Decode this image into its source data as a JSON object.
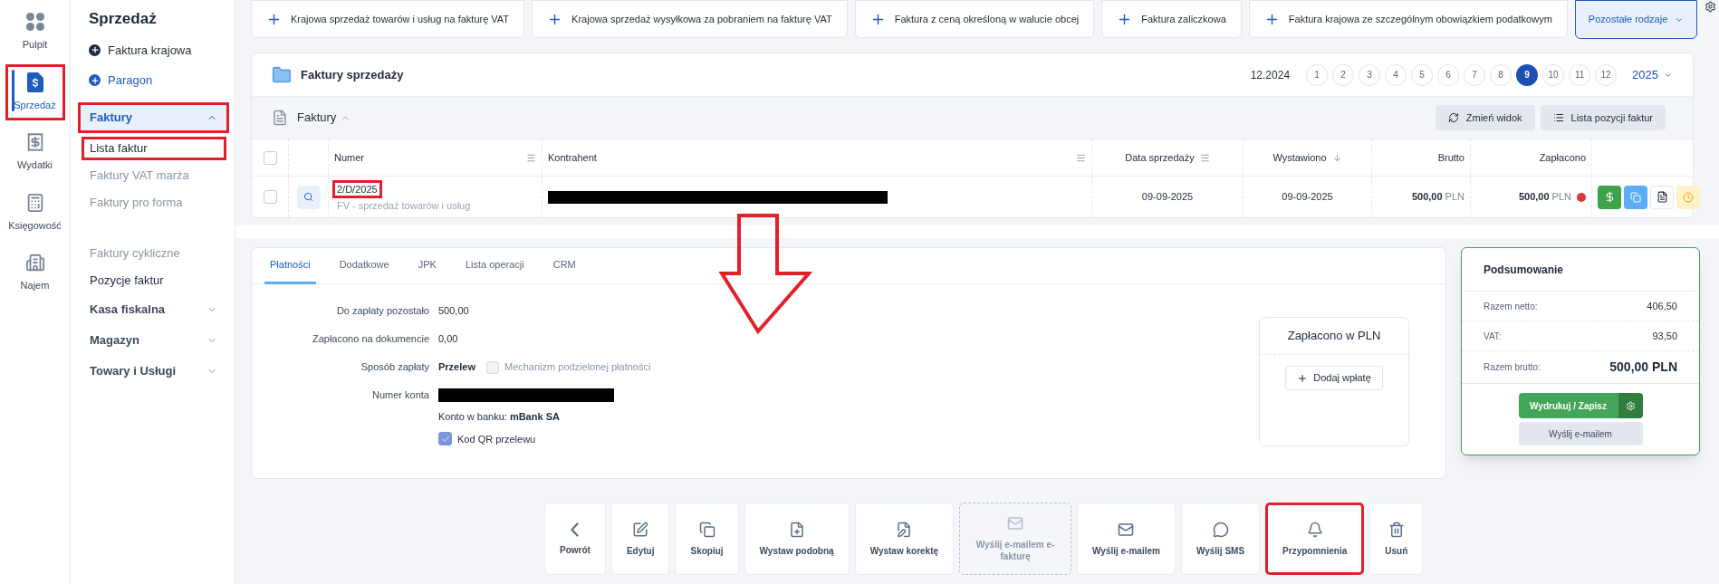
{
  "annotation_arrow": true,
  "rail": [
    {
      "label": "Pulpit",
      "kind": "dashboard",
      "selected": false,
      "highlighted": false
    },
    {
      "label": "Sprzedaż",
      "kind": "sales",
      "selected": true,
      "highlighted": true
    },
    {
      "label": "Wydatki",
      "kind": "expenses",
      "selected": false,
      "highlighted": false
    },
    {
      "label": "Księgowość",
      "kind": "accounting",
      "selected": false,
      "highlighted": false
    },
    {
      "label": "Najem",
      "kind": "rental",
      "selected": false,
      "highlighted": false
    }
  ],
  "sidebar": {
    "title": "Sprzedaż",
    "actions": [
      {
        "label": "Faktura krajowa",
        "color": "#1e2a3b"
      },
      {
        "label": "Paragon",
        "color": "#1d5bbf"
      }
    ],
    "groups": [
      {
        "label": "Faktury",
        "expanded": true,
        "highlighted": true,
        "children": [
          {
            "label": "Lista faktur",
            "disabled": false,
            "highlighted": true
          },
          {
            "label": "Faktury VAT marża",
            "disabled": true,
            "highlighted": false
          },
          {
            "label": "Faktury pro forma",
            "disabled": true,
            "highlighted": false
          },
          {
            "label": "Faktury cykliczne",
            "disabled": true,
            "highlighted": false
          },
          {
            "label": "Pozycje faktur",
            "disabled": false,
            "highlighted": false
          }
        ]
      },
      {
        "label": "Kasa fiskalna",
        "expanded": false,
        "highlighted": false
      },
      {
        "label": "Magazyn",
        "expanded": false,
        "highlighted": false
      },
      {
        "label": "Towary i Usługi",
        "expanded": false,
        "highlighted": false
      }
    ]
  },
  "quick_actions": [
    "Krajowa sprzedaż towarów i usług na fakturę VAT",
    "Krajowa sprzedaż wysyłkowa za pobraniem na fakturę VAT",
    "Faktura z ceną określoną w walucie obcej",
    "Faktura zaliczkowa",
    "Faktura krajowa ze szczególnym obowiązkiem podatkowym"
  ],
  "more_types": "Pozostałe rodzaje",
  "invoices": {
    "title": "Faktury sprzedaży",
    "period": "12.2024",
    "months": [
      {
        "label": "1",
        "selected": false
      },
      {
        "label": "2",
        "selected": false
      },
      {
        "label": "3",
        "selected": false
      },
      {
        "label": "4",
        "selected": false
      },
      {
        "label": "5",
        "selected": false
      },
      {
        "label": "6",
        "selected": false
      },
      {
        "label": "7",
        "selected": false
      },
      {
        "label": "8",
        "selected": false
      },
      {
        "label": "9",
        "selected": true
      },
      {
        "label": "10",
        "selected": false
      },
      {
        "label": "11",
        "selected": false
      },
      {
        "label": "12",
        "selected": false
      }
    ],
    "year": "2025",
    "list_title": "Faktury",
    "toolbar": [
      "Zmień widok",
      "Lista pozycji faktur"
    ],
    "select_all_checked": false,
    "columns": [
      {
        "label": "Numer",
        "menu": true,
        "sorted": false
      },
      {
        "label": "Kontrahent",
        "menu": true,
        "sorted": false
      },
      {
        "label": "Data sprzedaży",
        "menu": true,
        "sorted": false
      },
      {
        "label": "Wystawiono",
        "menu": false,
        "sorted": true
      },
      {
        "label": "Brutto",
        "menu": false,
        "sorted": false
      },
      {
        "label": "Zapłacono",
        "menu": false,
        "sorted": false
      }
    ],
    "rows": [
      {
        "checked": false,
        "number": "2/D/2025",
        "highlighted": true,
        "type": "FV - sprzedaż towarów i usług",
        "sale_date": "09-09-2025",
        "issued": "09-09-2025",
        "gross": "500,00",
        "gross_currency": "PLN",
        "paid": "500,00",
        "paid_currency": "PLN",
        "color": "#d63a3a"
      }
    ]
  },
  "detail": {
    "tabs": [
      {
        "label": "Płatności",
        "selected": true
      },
      {
        "label": "Dodatkowe",
        "selected": false
      },
      {
        "label": "JPK",
        "selected": false
      },
      {
        "label": "Lista operacji",
        "selected": false
      },
      {
        "label": "CRM",
        "selected": false
      }
    ],
    "fields": [
      {
        "label": "Do zapłaty pozostało",
        "kind": "text",
        "value": "500,00"
      },
      {
        "label": "Zapłacono na dokumencie",
        "kind": "text",
        "value": "0,00"
      },
      {
        "label": "Sposób zapłaty",
        "kind": "payment",
        "value": "Przelew",
        "option": "Mechanizm podzielonej płatności",
        "checked": false
      },
      {
        "label": "Numer konta",
        "kind": "redacted"
      }
    ],
    "bank": "Konto w banku: **mBank SA**",
    "qr": {
      "label": "Kod QR przelewu",
      "checked": true
    },
    "paid_box": {
      "title": "Zapłacono w PLN",
      "button": "Dodaj wpłatę"
    }
  },
  "summary": {
    "title": "Podsumowanie",
    "rows": [
      {
        "label": "Razem netto:",
        "value": "406,50",
        "kind": "normal"
      },
      {
        "label": "VAT:",
        "value": "93,50",
        "kind": "normal"
      },
      {
        "label": "Razem brutto:",
        "value": "500,00 PLN",
        "kind": "total"
      }
    ],
    "print": "Wydrukuj / Zapisz",
    "email": "Wyślij e-mailem"
  },
  "actions": [
    {
      "label": "Powrót",
      "kind": "back",
      "disabled": false,
      "highlighted": false
    },
    {
      "label": "Edytuj",
      "kind": "edit",
      "disabled": false,
      "highlighted": false
    },
    {
      "label": "Skopiuj",
      "kind": "copy",
      "disabled": false,
      "highlighted": false
    },
    {
      "label": "Wystaw podobną",
      "kind": "similar",
      "disabled": false,
      "highlighted": false
    },
    {
      "label": "Wystaw korektę",
      "kind": "correction",
      "disabled": false,
      "highlighted": false
    },
    {
      "label": "Wyślij e-mailem e-fakturę",
      "kind": "email",
      "disabled": true,
      "highlighted": false
    },
    {
      "label": "Wyślij e-mailem",
      "kind": "email",
      "disabled": false,
      "highlighted": false
    },
    {
      "label": "Wyślij SMS",
      "kind": "sms",
      "disabled": false,
      "highlighted": false
    },
    {
      "label": "Przypomnienia",
      "kind": "bell",
      "disabled": false,
      "highlighted": true
    },
    {
      "label": "Usuń",
      "kind": "delete",
      "disabled": false,
      "highlighted": false
    }
  ]
}
